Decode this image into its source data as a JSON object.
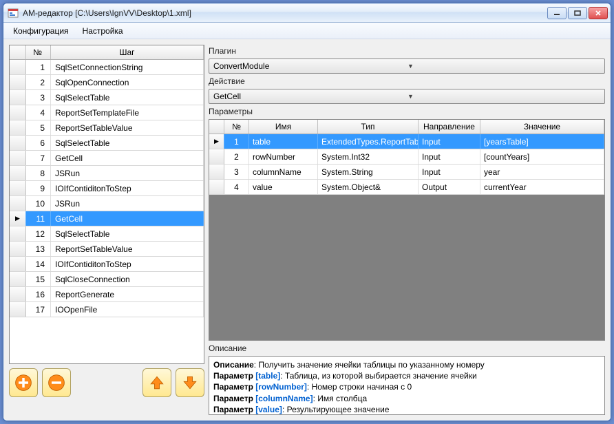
{
  "window": {
    "title": "АМ-редактор [C:\\Users\\IgnVV\\Desktop\\1.xml]"
  },
  "menu": {
    "config": "Конфигурация",
    "settings": "Настройка"
  },
  "steps": {
    "header_num": "№",
    "header_step": "Шаг",
    "selected_index": 11,
    "rows": [
      {
        "n": "1",
        "s": "SqlSetConnectionString"
      },
      {
        "n": "2",
        "s": "SqlOpenConnection"
      },
      {
        "n": "3",
        "s": "SqlSelectTable"
      },
      {
        "n": "4",
        "s": "ReportSetTemplateFile"
      },
      {
        "n": "5",
        "s": "ReportSetTableValue"
      },
      {
        "n": "6",
        "s": "SqlSelectTable"
      },
      {
        "n": "7",
        "s": "GetCell"
      },
      {
        "n": "8",
        "s": "JSRun"
      },
      {
        "n": "9",
        "s": "IOIfContiditonToStep"
      },
      {
        "n": "10",
        "s": "JSRun"
      },
      {
        "n": "11",
        "s": "GetCell"
      },
      {
        "n": "12",
        "s": "SqlSelectTable"
      },
      {
        "n": "13",
        "s": "ReportSetTableValue"
      },
      {
        "n": "14",
        "s": "IOIfContiditonToStep"
      },
      {
        "n": "15",
        "s": "SqlCloseConnection"
      },
      {
        "n": "16",
        "s": "ReportGenerate"
      },
      {
        "n": "17",
        "s": "IOOpenFile"
      }
    ]
  },
  "plugin": {
    "label": "Плагин",
    "value": "ConvertModule"
  },
  "action": {
    "label": "Действие",
    "value": "GetCell"
  },
  "params": {
    "label": "Параметры",
    "headers": {
      "num": "№",
      "name": "Имя",
      "type": "Тип",
      "dir": "Направление",
      "val": "Значение"
    },
    "selected_index": 1,
    "rows": [
      {
        "n": "1",
        "name": "table",
        "type": "ExtendedTypes.ReportTable",
        "dir": "Input",
        "val": "[yearsTable]"
      },
      {
        "n": "2",
        "name": "rowNumber",
        "type": "System.Int32",
        "dir": "Input",
        "val": "[countYears]"
      },
      {
        "n": "3",
        "name": "columnName",
        "type": "System.String",
        "dir": "Input",
        "val": "year"
      },
      {
        "n": "4",
        "name": "value",
        "type": "System.Object&",
        "dir": "Output",
        "val": "currentYear"
      }
    ]
  },
  "desc": {
    "label": "Описание",
    "title_label": "Описание",
    "title_text": "Получить значение ячейки таблицы по указанному номеру",
    "param_label": "Параметр",
    "lines": [
      {
        "name": "[table]",
        "text": "Таблица, из которой выбирается значение ячейки"
      },
      {
        "name": "[rowNumber]",
        "text": "Номер строки начиная с 0"
      },
      {
        "name": "[columnName]",
        "text": "Имя столбца"
      },
      {
        "name": "[value]",
        "text": "Результирующее значение"
      }
    ]
  }
}
